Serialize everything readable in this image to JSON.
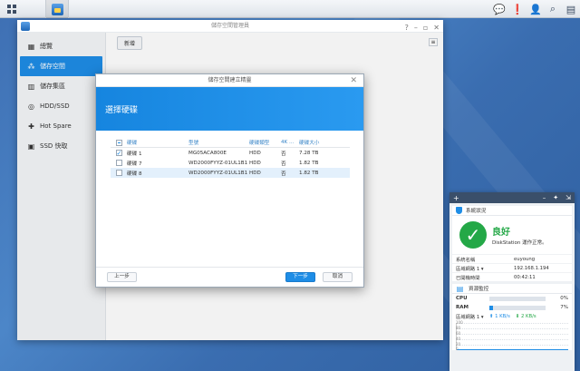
{
  "taskbar": {
    "main_menu_icon": "grid-icon",
    "app_icon": "storage-manager-icon",
    "right_icons": [
      "chat-icon",
      "notification-icon",
      "user-icon",
      "search-icon",
      "widgets-icon"
    ]
  },
  "window": {
    "title": "儲存空間管理員",
    "sidebar": [
      {
        "label": "總覽",
        "icon": "overview-icon",
        "active": false
      },
      {
        "label": "儲存空間",
        "icon": "volume-icon",
        "active": true
      },
      {
        "label": "儲存集區",
        "icon": "pool-icon",
        "active": false
      },
      {
        "label": "HDD/SSD",
        "icon": "hdd-icon",
        "active": false
      },
      {
        "label": "Hot Spare",
        "icon": "hotspare-icon",
        "active": false
      },
      {
        "label": "SSD 快取",
        "icon": "ssd-cache-icon",
        "active": false
      }
    ],
    "toolbar": {
      "new_label": "新增"
    }
  },
  "dialog": {
    "title": "儲存空間建立精靈",
    "heading": "選擇硬碟",
    "columns": [
      "硬碟",
      "型號",
      "硬碟類型",
      "4K ...",
      "硬碟大小"
    ],
    "disks": [
      {
        "name": "硬碟 1",
        "model": "MG05ACA800E",
        "type": "HDD",
        "native4k": "否",
        "size": "7.28 TB",
        "checked": true
      },
      {
        "name": "硬碟 7",
        "model": "WD2000FYYZ-01UL1B1",
        "type": "HDD",
        "native4k": "否",
        "size": "1.82 TB",
        "checked": false
      },
      {
        "name": "硬碟 8",
        "model": "WD2000FYYZ-01UL1B1",
        "type": "HDD",
        "native4k": "否",
        "size": "1.82 TB",
        "checked": false
      }
    ],
    "buttons": {
      "prev": "上一步",
      "next": "下一步",
      "cancel": "取消"
    }
  },
  "widget": {
    "health": {
      "title": "系統狀況",
      "status": "良好",
      "subtitle": "DiskStation 運作正常。",
      "rows": [
        {
          "key": "系統名稱",
          "value": "euyoung"
        },
        {
          "key": "區域網路 1 ▾",
          "value": "192.168.1.194"
        },
        {
          "key": "已開機時間",
          "value": "00:42:11"
        }
      ]
    },
    "resource": {
      "title": "資源監控",
      "cpu_label": "CPU",
      "cpu_pct": "0%",
      "cpu_value": 0.0,
      "ram_label": "RAM",
      "ram_pct": "7%",
      "ram_value": 0.07,
      "net_label": "區域網路 1 ▾",
      "up": "⬆ 1 KB/s",
      "down": "⬇ 2 KB/s",
      "graph_labels": [
        "100",
        "80",
        "60",
        "40",
        "20",
        "0"
      ]
    }
  }
}
